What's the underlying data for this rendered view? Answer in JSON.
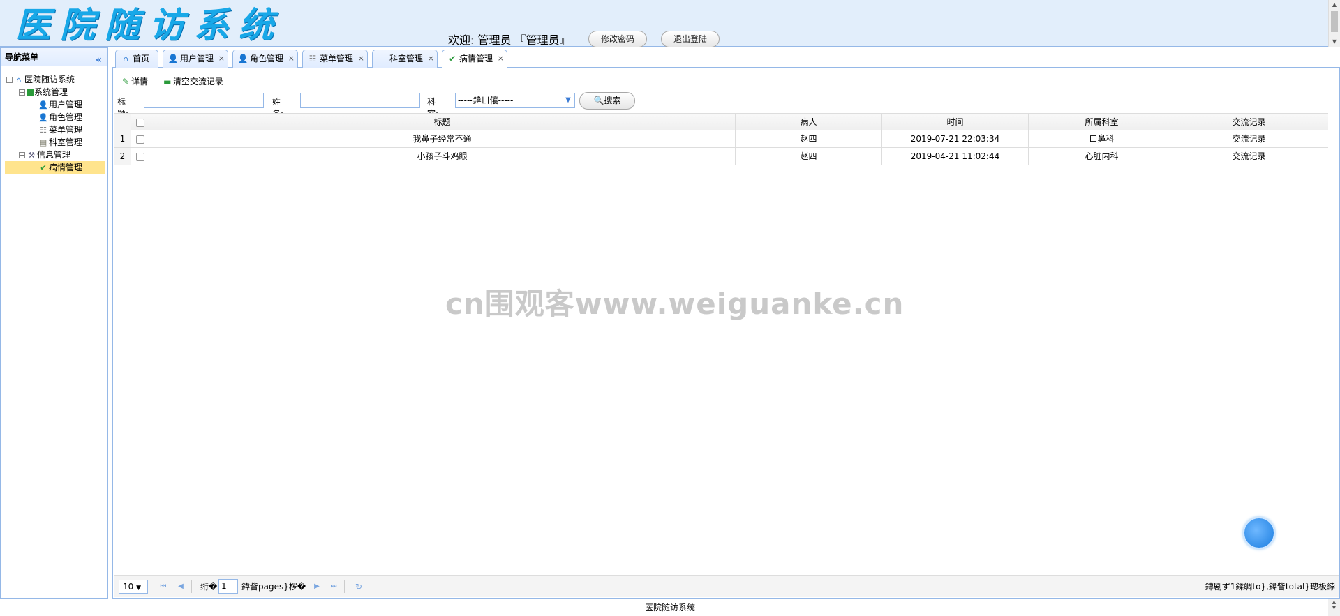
{
  "header": {
    "logo": "医院随访系统",
    "welcome": "欢迎: 管理员 『管理员』",
    "change_password": "修改密码",
    "logout": "退出登陆"
  },
  "nav": {
    "title": "导航菜单",
    "collapse_icon": "«",
    "tree": [
      {
        "label": "医院随访系统",
        "icon": "home-icon"
      },
      {
        "label": "系统管理",
        "icon": "folder-icon"
      },
      {
        "label": "用户管理",
        "icon": "user-icon"
      },
      {
        "label": "角色管理",
        "icon": "role-icon"
      },
      {
        "label": "菜单管理",
        "icon": "menu-icon"
      },
      {
        "label": "科室管理",
        "icon": "document-icon"
      },
      {
        "label": "信息管理",
        "icon": "tools-icon"
      },
      {
        "label": "病情管理",
        "icon": "check-icon"
      }
    ]
  },
  "tabs": [
    {
      "label": "首页"
    },
    {
      "label": "用户管理"
    },
    {
      "label": "角色管理"
    },
    {
      "label": "菜单管理"
    },
    {
      "label": "科室管理"
    },
    {
      "label": "病情管理"
    }
  ],
  "toolbar": {
    "detail": "详情",
    "clear": "清空交流记录"
  },
  "search": {
    "title_label": "标题:",
    "title_value": "",
    "name_label": "姓名:",
    "name_value": "",
    "dept_label": "科室:",
    "dept_selected": "-----鍏ㄩ儴-----",
    "search_button": "搜索"
  },
  "grid": {
    "headers": [
      "标题",
      "病人",
      "时间",
      "所属科室",
      "交流记录"
    ],
    "rows": [
      {
        "num": "1",
        "title": "我鼻子经常不通",
        "patient": "赵四",
        "time": "2019-07-21 22:03:34",
        "dept": "口鼻科",
        "record": "交流记录"
      },
      {
        "num": "2",
        "title": "小孩子斗鸡眼",
        "patient": "赵四",
        "time": "2019-04-21 11:02:44",
        "dept": "心脏内科",
        "record": "交流记录"
      }
    ]
  },
  "watermark": "cn围观客www.weiguanke.cn",
  "pager": {
    "page_size": "10",
    "before_page": "绗�",
    "current_page": "1",
    "after_page": "鍏眥pages}椤�",
    "info": "鏄剧ず1鍒皗to},鍏眥total}璁板綍"
  },
  "footer": {
    "text": "医院随访系统"
  },
  "colors": {
    "header_bg": "#e2eefb",
    "border": "#95b8e7",
    "logo": "#18a8e8",
    "selected_node": "#ffe48d"
  }
}
